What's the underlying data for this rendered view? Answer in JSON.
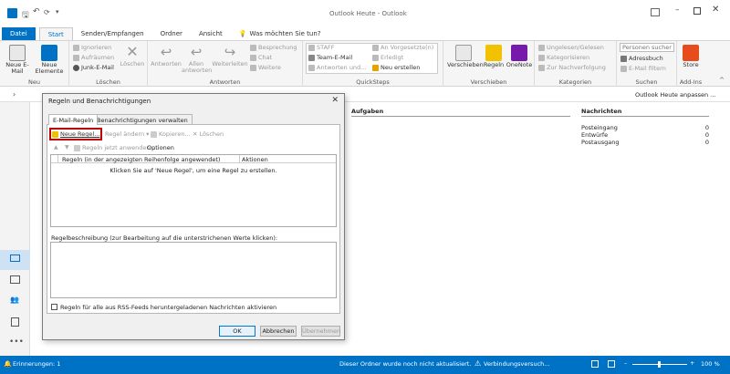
{
  "window": {
    "title": "Outlook Heute - Outlook",
    "search_hint": "Was möchten Sie tun?"
  },
  "tabs": [
    {
      "label": "Datei"
    },
    {
      "label": "Start"
    },
    {
      "label": "Senden/Empfangen"
    },
    {
      "label": "Ordner"
    },
    {
      "label": "Ansicht"
    }
  ],
  "ribbon": {
    "neu": {
      "label": "Neu",
      "new_email": "Neue E-Mail",
      "new_items": "Neue Elemente"
    },
    "loeschen": {
      "label": "Löschen",
      "ignore": "Ignorieren",
      "cleanup": "Aufräumen",
      "junk": "Junk-E-Mail",
      "delete": "Löschen"
    },
    "antworten": {
      "label": "Antworten",
      "reply": "Antworten",
      "reply_all": "Allen antworten",
      "forward": "Weiterleiten",
      "meeting": "Besprechung",
      "chat": "Chat",
      "more": "Weitere"
    },
    "quicksteps": {
      "label": "QuickSteps",
      "items": [
        "STAFF",
        "Team-E-Mail",
        "Antworten und...",
        "An Vorgesetzte(n)",
        "Erledigt",
        "Neu erstellen"
      ]
    },
    "verschieben": {
      "label": "Verschieben",
      "move": "Verschieben",
      "rules": "Regeln",
      "onenote": "OneNote"
    },
    "kategorien": {
      "label": "Kategorien",
      "unread": "Ungelesen/Gelesen",
      "categorize": "Kategorisieren",
      "followup": "Zur Nachverfolgung"
    },
    "suchen": {
      "label": "Suchen",
      "search_placeholder": "Personen suchen",
      "addressbook": "Adressbuch",
      "filter": "E-Mail filtern"
    },
    "addins": {
      "label": "Add-Ins",
      "store": "Store"
    }
  },
  "main": {
    "customize": "Outlook Heute anpassen ...",
    "tasks_header": "Aufgaben",
    "messages_header": "Nachrichten",
    "messages": [
      {
        "name": "Posteingang",
        "count": "0"
      },
      {
        "name": "Entwürfe",
        "count": "0"
      },
      {
        "name": "Postausgang",
        "count": "0"
      }
    ]
  },
  "dialog": {
    "title": "Regeln und Benachrichtigungen",
    "tabs": [
      "E-Mail-Regeln",
      "Benachrichtigungen verwalten"
    ],
    "toolbar": {
      "new_rule": "Neue Regel...",
      "change_rule": "Regel ändern",
      "copy": "Kopieren...",
      "delete": "Löschen"
    },
    "run_rules": "Regeln jetzt anwenden...",
    "options": "Optionen",
    "col_rule": "Regeln (in der angezeigten Reihenfolge angewendet)",
    "col_actions": "Aktionen",
    "empty_text": "Klicken Sie auf 'Neue Regel', um eine Regel zu erstellen.",
    "desc_label": "Regelbeschreibung (zur Bearbeitung auf die unterstrichenen Werte klicken):",
    "rss_checkbox": "Regeln für alle aus RSS-Feeds heruntergeladenen Nachrichten aktivieren",
    "ok": "OK",
    "cancel": "Abbrechen",
    "apply": "Übernehmen"
  },
  "status": {
    "reminders": "Erinnerungen: 1",
    "not_updated": "Dieser Ordner wurde noch nicht aktualisiert.",
    "connecting": "Verbindungsversuch...",
    "zoom": "100 %"
  },
  "colors": {
    "accent": "#0072c6",
    "highlight": "#c00000"
  }
}
